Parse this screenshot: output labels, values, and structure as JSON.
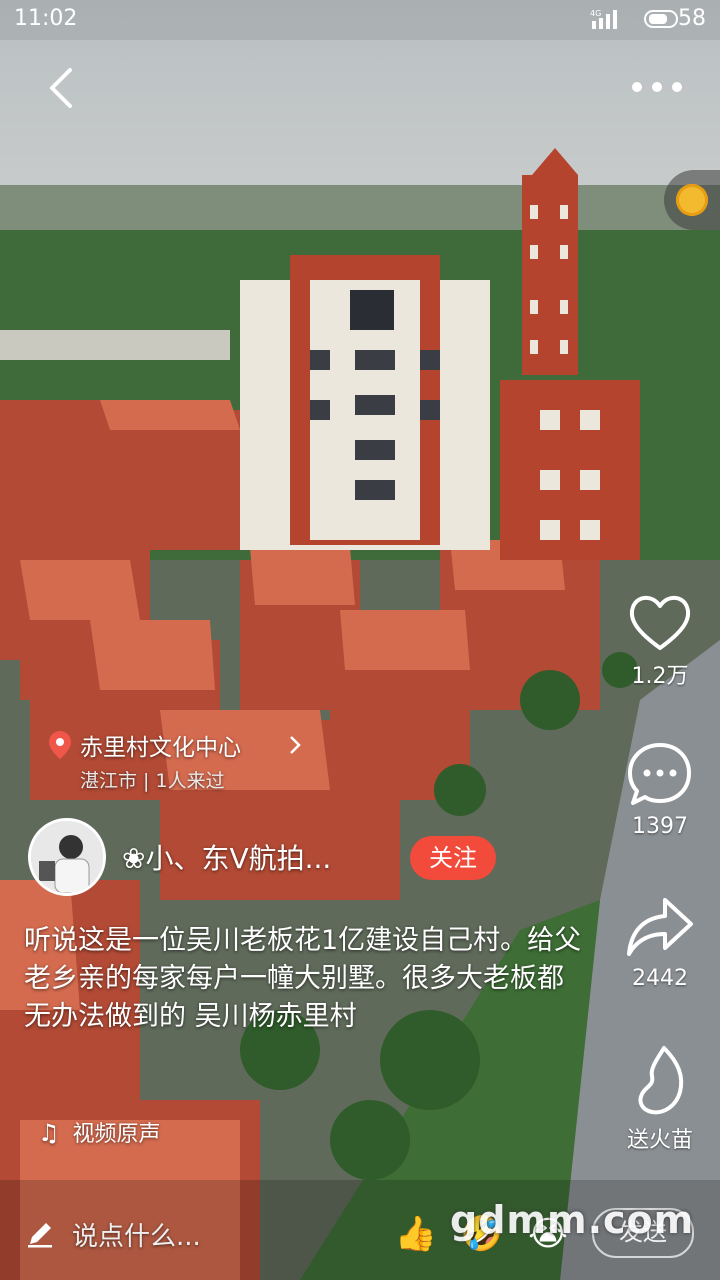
{
  "status_bar": {
    "time": "11:02",
    "network": "4G",
    "battery": "58"
  },
  "header": {
    "back_icon": "chevron-left-icon",
    "more_icon": "more-icon"
  },
  "sidebar": {
    "like_count": "1.2万",
    "comment_count": "1397",
    "share_count": "2442",
    "gift_label": "送火苗"
  },
  "location": {
    "title": "赤里村文化中心",
    "subtitle": "湛江市 | 1人来过"
  },
  "author": {
    "name": "❀小、东V航拍...",
    "follow_label": "关注"
  },
  "caption": "听说这是一位吴川老板花1亿建设自己村。给父老乡亲的每家每户一幢大别墅。很多大老板都无办法做到的 吴川杨赤里村",
  "music": {
    "label": "视频原声"
  },
  "bottom": {
    "comment_placeholder": "说点什么...",
    "send_label": "发送",
    "emojis": [
      "👍",
      "🤣",
      "😭"
    ]
  },
  "watermark": "gdmm.com"
}
